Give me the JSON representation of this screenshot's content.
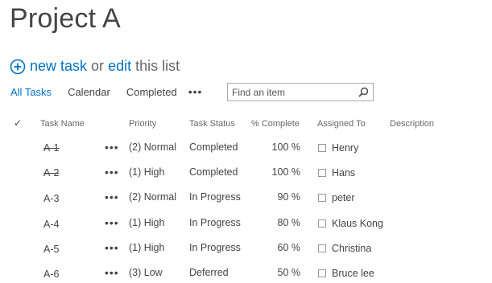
{
  "page": {
    "title": "Project A"
  },
  "actions": {
    "new_task": "new task",
    "or_text": "or",
    "edit": "edit",
    "this_list": "this list"
  },
  "views": [
    {
      "label": "All Tasks",
      "active": true
    },
    {
      "label": "Calendar",
      "active": false
    },
    {
      "label": "Completed",
      "active": false
    }
  ],
  "views_more": "•••",
  "search": {
    "placeholder": "Find an item"
  },
  "columns": {
    "check": "✓",
    "task_name": "Task Name",
    "priority": "Priority",
    "task_status": "Task Status",
    "percent_complete": "% Complete",
    "assigned_to": "Assigned To",
    "description": "Description"
  },
  "row_menu": "•••",
  "rows": [
    {
      "name": "A-1",
      "priority": "(2) Normal",
      "status": "Completed",
      "percent": "100 %",
      "assigned": "Henry",
      "done": true
    },
    {
      "name": "A-2",
      "priority": "(1) High",
      "status": "Completed",
      "percent": "100 %",
      "assigned": "Hans",
      "done": true
    },
    {
      "name": "A-3",
      "priority": "(2) Normal",
      "status": "In Progress",
      "percent": "90 %",
      "assigned": "peter",
      "done": false
    },
    {
      "name": "A-4",
      "priority": "(1) High",
      "status": "In Progress",
      "percent": "80 %",
      "assigned": "Klaus Kong",
      "done": false
    },
    {
      "name": "A-5",
      "priority": "(1) High",
      "status": "In Progress",
      "percent": "60 %",
      "assigned": "Christina",
      "done": false
    },
    {
      "name": "A-6",
      "priority": "(3) Low",
      "status": "Deferred",
      "percent": "50 %",
      "assigned": "Bruce lee",
      "done": false
    }
  ],
  "colors": {
    "accent": "#0072c6",
    "text": "#444444"
  }
}
